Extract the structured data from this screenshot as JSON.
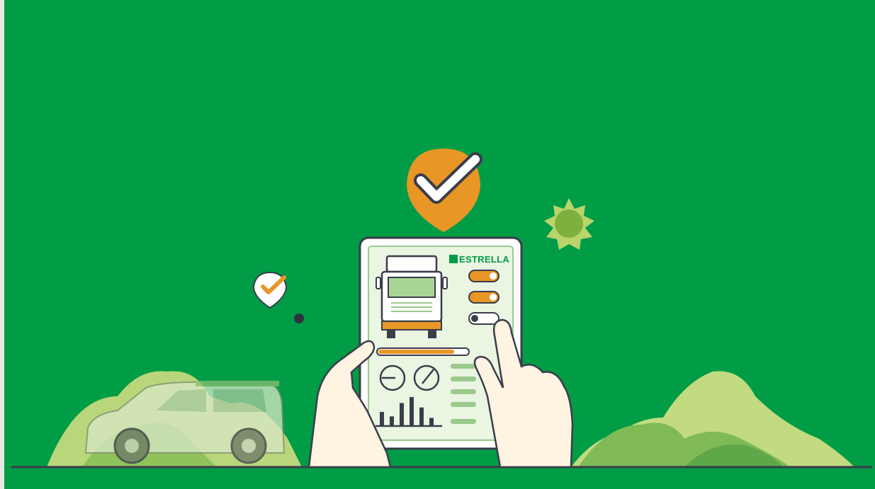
{
  "brand": {
    "name": "ESTRELLA"
  },
  "colors": {
    "background": "#019c46",
    "accent": "#e89626",
    "screen": "#eaf5e2",
    "outline": "#3a3d4a",
    "hills_light": "#c7dd86",
    "hills_mid": "#93c45c",
    "hills_dark": "#5fa84a"
  },
  "tablet": {
    "toggles": [
      {
        "name": "toggle-1",
        "on": true
      },
      {
        "name": "toggle-2",
        "on": true
      },
      {
        "name": "toggle-3",
        "on": false
      }
    ],
    "progress": 0.85,
    "bars": [
      0.45,
      0.3,
      0.75,
      0.95,
      0.6,
      0.25
    ]
  }
}
